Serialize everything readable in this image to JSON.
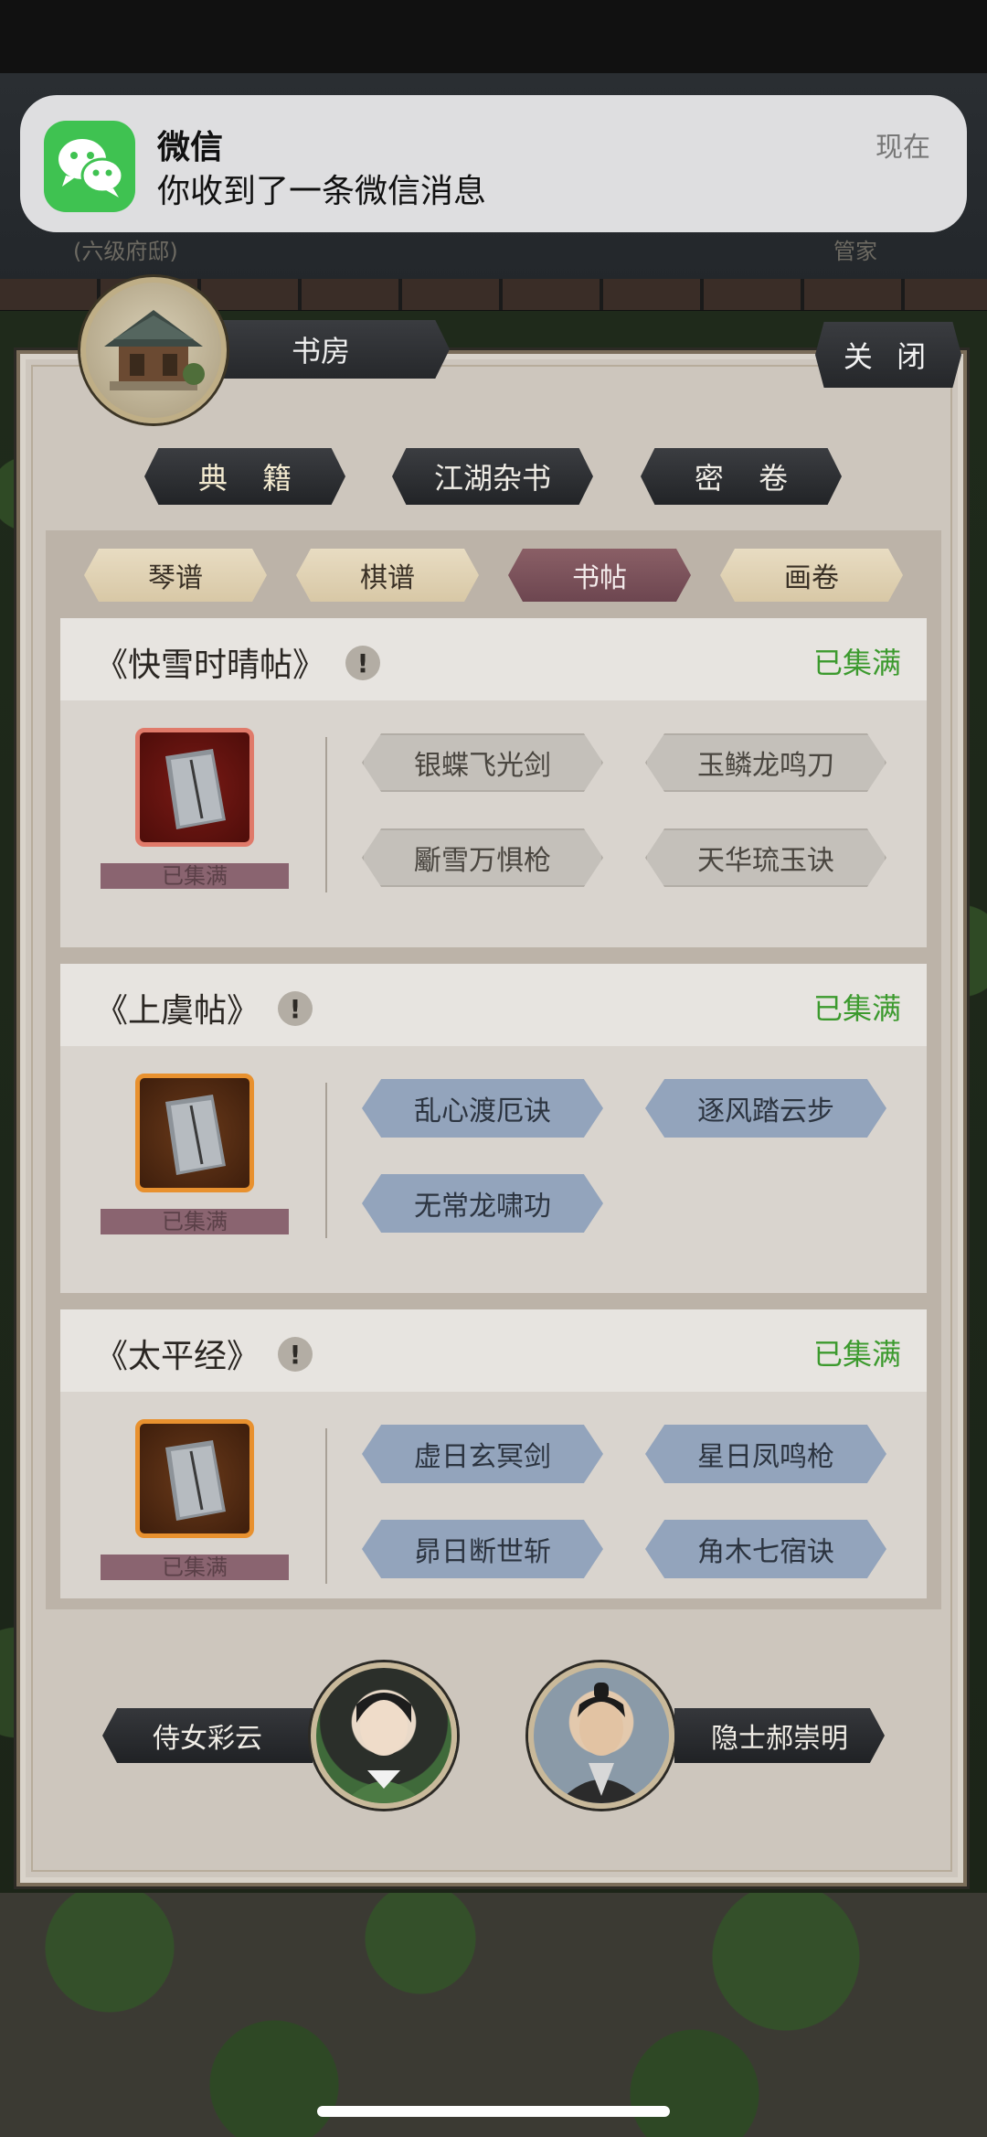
{
  "background": {
    "top_left_text": "(六级府邸)",
    "top_right_text": "管家"
  },
  "notification": {
    "app_name": "微信",
    "message": "你收到了一条微信消息",
    "time": "现在",
    "icon": "wechat-icon"
  },
  "header": {
    "title": "书房",
    "close_label": "关 闭"
  },
  "categories": [
    {
      "label": "典 籍",
      "active": true
    },
    {
      "label": "江湖杂书",
      "active": false
    },
    {
      "label": "密 卷",
      "active": false
    }
  ],
  "sub_tabs": [
    {
      "label": "琴谱",
      "active": false
    },
    {
      "label": "棋谱",
      "active": false
    },
    {
      "label": "书帖",
      "active": true
    },
    {
      "label": "画卷",
      "active": false
    }
  ],
  "items": [
    {
      "title": "《快雪时晴帖》",
      "status": "已集满",
      "collected_label": "已集满",
      "skills": [
        "银蝶飞光剑",
        "玉鳞龙鸣刀",
        "斸雪万惧枪",
        "天华琉玉诀"
      ]
    },
    {
      "title": "《上虞帖》",
      "status": "已集满",
      "collected_label": "已集满",
      "skills": [
        "乱心渡厄诀",
        "逐风踏云步",
        "无常龙啸功"
      ]
    },
    {
      "title": "《太平经》",
      "status": "已集满",
      "collected_label": "已集满",
      "skills": [
        "虚日玄冥剑",
        "星日凤鸣枪",
        "昴日断世斩",
        "角木七宿诀"
      ]
    }
  ],
  "npcs": [
    {
      "label": "侍女彩云"
    },
    {
      "label": "隐士郝崇明"
    }
  ],
  "colors": {
    "status_green": "#3c9a2e",
    "active_subtab": "#7a5059",
    "panel_bg": "#cdc6bd"
  }
}
